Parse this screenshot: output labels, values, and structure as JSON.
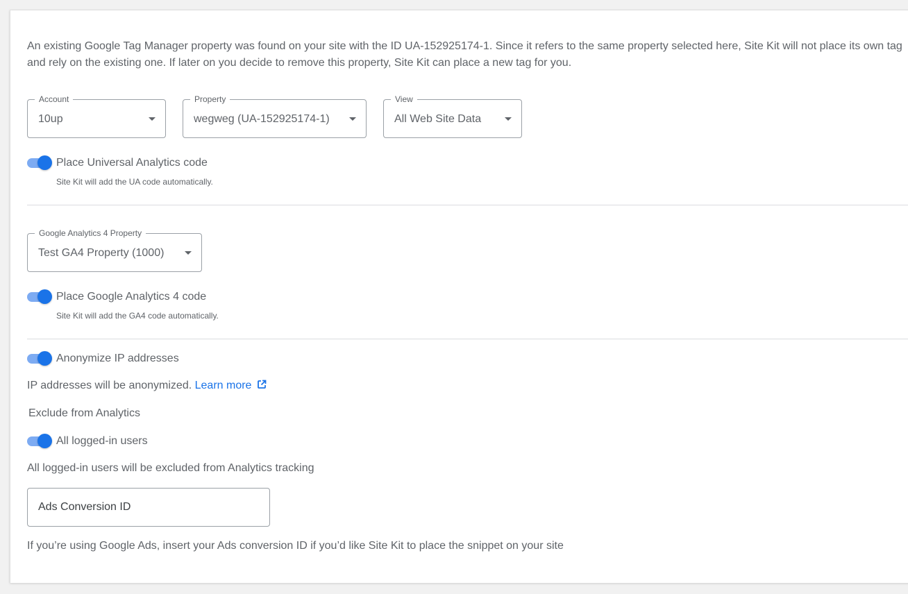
{
  "notice": "An existing Google Tag Manager property was found on your site with the ID UA-152925174-1. Since it refers to the same property selected here, Site Kit will not place its own tag and rely on the existing one. If later on you decide to remove this property, Site Kit can place a new tag for you.",
  "selects": {
    "account": {
      "label": "Account",
      "value": "10up"
    },
    "property": {
      "label": "Property",
      "value": "wegweg (UA-152925174-1)"
    },
    "view": {
      "label": "View",
      "value": "All Web Site Data"
    },
    "ga4_property": {
      "label": "Google Analytics 4 Property",
      "value": "Test GA4 Property (1000)"
    }
  },
  "toggles": {
    "ua_code": {
      "label": "Place Universal Analytics code",
      "help": "Site Kit will add the UA code automatically.",
      "on": true
    },
    "ga4_code": {
      "label": "Place Google Analytics 4 code",
      "help": "Site Kit will add the GA4 code automatically.",
      "on": true
    },
    "anonymize_ip": {
      "label": "Anonymize IP addresses",
      "on": true
    },
    "logged_in_users": {
      "label": "All logged-in users",
      "on": true
    }
  },
  "anonymize": {
    "text": "IP addresses will be anonymized.",
    "link": "Learn more",
    "icon": "external-link-icon"
  },
  "exclude": {
    "heading": "Exclude from Analytics",
    "description": "All logged-in users will be excluded from Analytics tracking"
  },
  "ads": {
    "placeholder": "Ads Conversion ID",
    "helper": "If you’re using Google Ads, insert your Ads conversion ID if you’d like Site Kit to place the snippet on your site"
  },
  "colors": {
    "accent": "#1a73e8",
    "toggle_track": "#7dabf2",
    "text": "#5f6368",
    "background": "#f1f1f1"
  }
}
